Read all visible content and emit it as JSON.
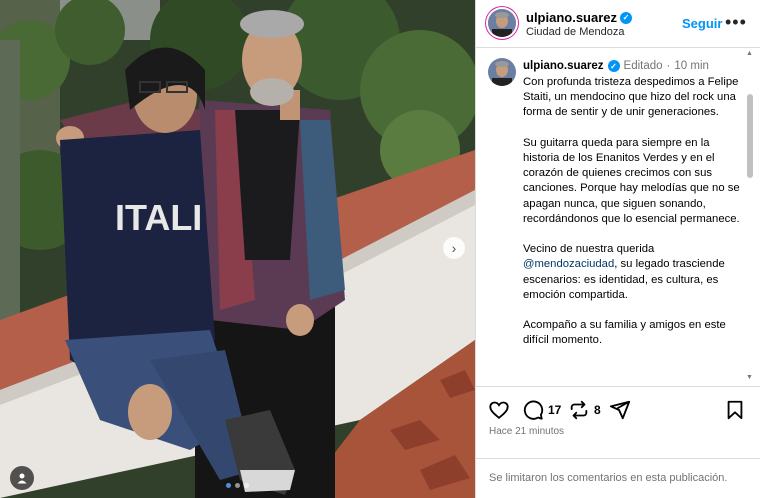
{
  "post": {
    "username": "ulpiano.suarez",
    "location": "Ciudad de Mendoza",
    "follow_label": "Seguir",
    "more_label": "•••",
    "verified": true
  },
  "caption": {
    "username": "ulpiano.suarez",
    "edited_label": "Editado",
    "separator": "·",
    "time": "10 min",
    "para1": "Con profunda tristeza despedimos a Felipe Staiti, un mendocino que hizo del rock una forma de sentir y de unir generaciones.",
    "para2": "Su guitarra queda para siempre en la historia de los Enanitos Verdes y en el corazón de quienes crecimos con sus canciones. Porque hay melodías que no se apagan nunca, que siguen sonando, recordándonos que lo esencial permanece.",
    "para3_pre": "Vecino de nuestra querida ",
    "para3_mention": "@mendozaciudad",
    "para3_post": ", su legado trasciende escenarios: es identidad, es cultura, es emoción compartida.",
    "para4": "Acompaño a su familia y amigos en este difícil momento."
  },
  "actions": {
    "comment_count": "17",
    "repost_count": "8",
    "posted_ago": "Hace 21 minutos"
  },
  "footer": {
    "comments_disabled": "Se limitaron los comentarios en esta publicación."
  },
  "carousel": {
    "slides": 3,
    "active_slide": 1
  },
  "colors": {
    "accent": "#0095f6",
    "mention": "#00376b",
    "muted": "#737373",
    "border": "#dbdbdb"
  },
  "icons": [
    "heart-icon",
    "comment-icon",
    "repost-icon",
    "share-icon",
    "bookmark-icon",
    "more-icon",
    "verified-icon",
    "chevron-right-icon",
    "user-tag-icon"
  ]
}
